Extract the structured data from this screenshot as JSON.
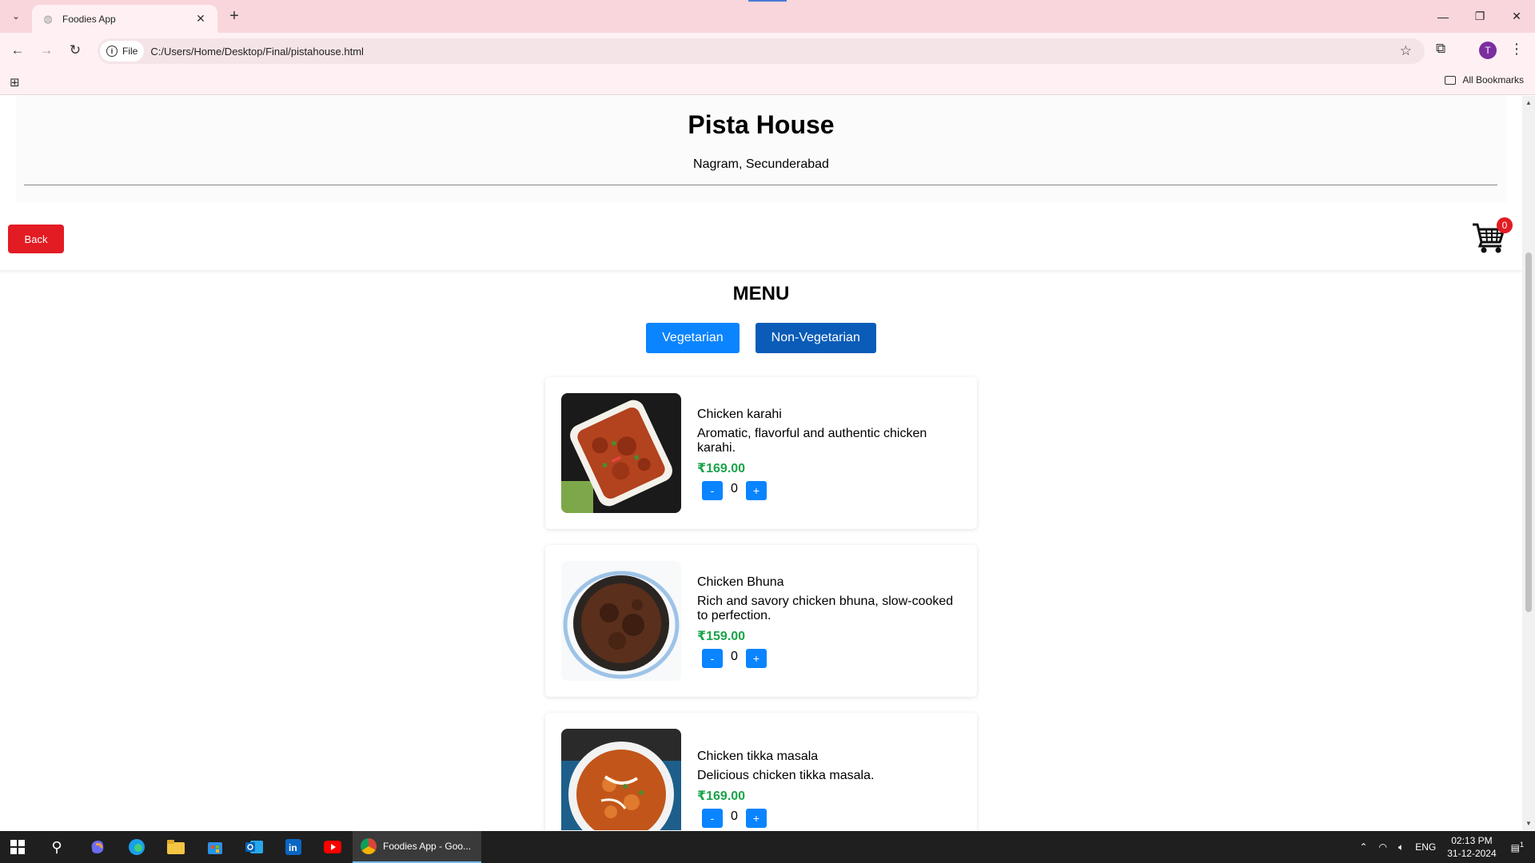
{
  "browser": {
    "tab_title": "Foodies App",
    "url_chip": "File",
    "url": "C:/Users/Home/Desktop/Final/pistahouse.html",
    "bookmarks_label": "All Bookmarks",
    "profile_initial": "T"
  },
  "restaurant": {
    "name": "Pista House",
    "location": "Nagram, Secunderabad"
  },
  "actions": {
    "back_label": "Back",
    "cart_count": "0"
  },
  "menu": {
    "title": "MENU",
    "categories": [
      "Vegetarian",
      "Non-Vegetarian"
    ],
    "items": [
      {
        "name": "Chicken karahi",
        "description": "Aromatic, flavorful and authentic chicken karahi.",
        "price": "₹169.00",
        "qty": "0",
        "minus": "-",
        "plus": "+"
      },
      {
        "name": "Chicken Bhuna",
        "description": "Rich and savory chicken bhuna, slow-cooked to perfection.",
        "price": "₹159.00",
        "qty": "0",
        "minus": "-",
        "plus": "+"
      },
      {
        "name": "Chicken tikka masala",
        "description": "Delicious chicken tikka masala.",
        "price": "₹169.00",
        "qty": "0",
        "minus": "-",
        "plus": "+"
      }
    ]
  },
  "taskbar": {
    "active_app": "Foodies App - Goo...",
    "lang": "ENG",
    "time": "02:13 PM",
    "date": "31-12-2024",
    "notif_count": "1"
  },
  "colors": {
    "back_button": "#e31b23",
    "veg_tab": "#0a84ff",
    "nonveg_tab": "#0a5cb8",
    "price": "#1aa34a"
  }
}
